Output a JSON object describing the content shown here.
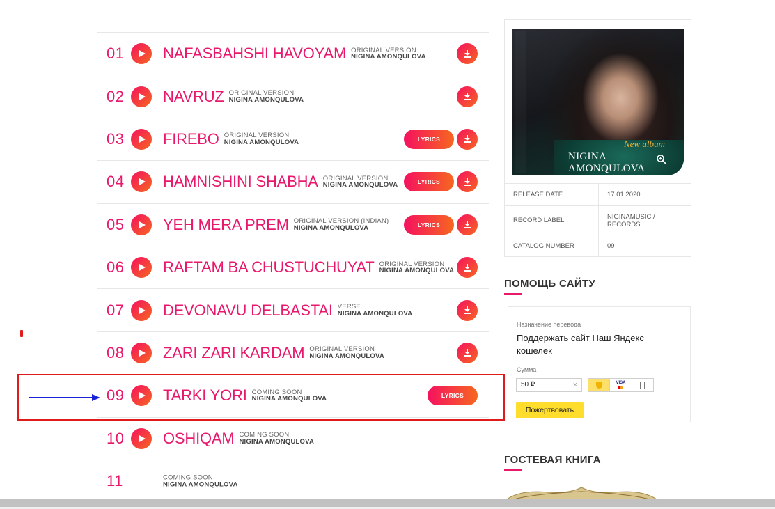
{
  "tracks": [
    {
      "num": "01",
      "title": "NAFASBAHSHI HAVOYAM",
      "version": "ORIGINAL VERSION",
      "artist": "NIGINA AMONQULOVA",
      "lyrics": false,
      "download": true
    },
    {
      "num": "02",
      "title": "NAVRUZ",
      "version": "ORIGINAL VERSION",
      "artist": "NIGINA AMONQULOVA",
      "lyrics": false,
      "download": true
    },
    {
      "num": "03",
      "title": "FIREBO",
      "version": "ORIGINAL VERSION",
      "artist": "NIGINA AMONQULOVA",
      "lyrics": true,
      "download": true
    },
    {
      "num": "04",
      "title": "HAMNISHINI SHABHA",
      "version": "ORIGINAL VERSION",
      "artist": "NIGINA AMONQULOVA",
      "lyrics": true,
      "download": true
    },
    {
      "num": "05",
      "title": "YEH MERA PREM",
      "version": "ORIGINAL VERSION (INDIAN)",
      "artist": "NIGINA AMONQULOVA",
      "lyrics": true,
      "download": true
    },
    {
      "num": "06",
      "title": "RAFTAM BA CHUSTUCHUYAT",
      "version": "ORIGINAL VERSION",
      "artist": "NIGINA AMONQULOVA",
      "lyrics": false,
      "download": true
    },
    {
      "num": "07",
      "title": "DEVONAVU DELBASTAI",
      "version": "VERSE",
      "artist": "NIGINA AMONQULOVA",
      "lyrics": false,
      "download": true
    },
    {
      "num": "08",
      "title": "ZARI ZARI KARDAM",
      "version": "ORIGINAL VERSION",
      "artist": "NIGINA AMONQULOVA",
      "lyrics": false,
      "download": true
    },
    {
      "num": "09",
      "title": "TARKI YORI",
      "version": "COMING SOON",
      "artist": "NIGINA AMONQULOVA",
      "lyrics": true,
      "download": false
    },
    {
      "num": "10",
      "title": "OSHIQAM",
      "version": "COMING SOON",
      "artist": "NIGINA AMONQULOVA",
      "lyrics": false,
      "download": false
    },
    {
      "num": "11",
      "title": "",
      "version": "COMING SOON",
      "artist": "NIGINA AMONQULOVA",
      "lyrics": false,
      "download": false,
      "noplay": true
    }
  ],
  "lyrics_label": "LYRICS",
  "cover": {
    "new_album": "New album",
    "artist": "NIGINA AMONQULOVA"
  },
  "release_info": [
    {
      "key": "RELEASE DATE",
      "value": "17.01.2020"
    },
    {
      "key": "RECORD LABEL",
      "value": "NIGINAMUSIC / RECORDS"
    },
    {
      "key": "CATALOG NUMBER",
      "value": "09"
    }
  ],
  "sidebar": {
    "help_heading": "ПОМОЩЬ САЙТУ",
    "guestbook_heading": "ГОСТЕВАЯ КНИГА"
  },
  "donate": {
    "purpose_label": "Назначение перевода",
    "purpose": "Поддержать сайт Наш Яндекс кошелек",
    "amount_label": "Сумма",
    "amount": "50 ₽",
    "clear": "×",
    "visa": "VISA",
    "button": "Пожертвовать"
  },
  "colors": {
    "accent": "#e8196c",
    "gradient_end": "#f6671f",
    "annotation_box": "#e01b1b",
    "annotation_arrow": "#1a22d6"
  }
}
